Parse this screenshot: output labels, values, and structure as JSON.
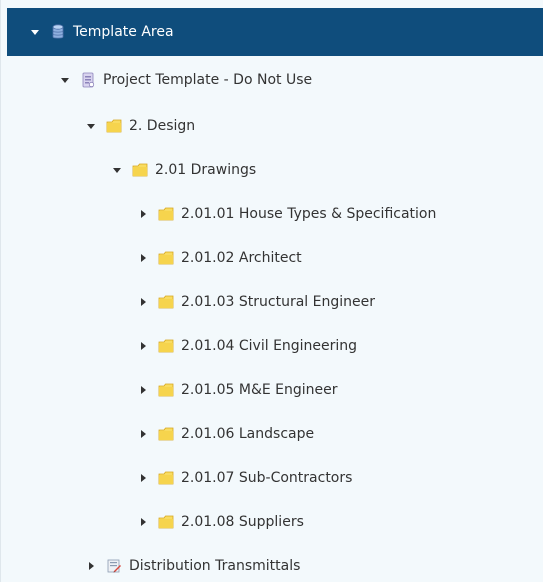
{
  "tree": {
    "root": {
      "label": "Template Area",
      "icon": "database-icon",
      "expanded": true
    },
    "project": {
      "label": "Project Template - Do Not Use",
      "icon": "project-icon",
      "expanded": true
    },
    "design": {
      "label": "2. Design",
      "icon": "folder-icon",
      "expanded": true
    },
    "drawings": {
      "label": "2.01 Drawings",
      "icon": "folder-icon",
      "expanded": true
    },
    "children": [
      {
        "label": "2.01.01 House Types & Specification",
        "icon": "folder-icon",
        "expanded": false
      },
      {
        "label": "2.01.02 Architect",
        "icon": "folder-icon",
        "expanded": false
      },
      {
        "label": "2.01.03 Structural Engineer",
        "icon": "folder-icon",
        "expanded": false
      },
      {
        "label": "2.01.04 Civil Engineering",
        "icon": "folder-icon",
        "expanded": false
      },
      {
        "label": "2.01.05 M&E Engineer",
        "icon": "folder-icon",
        "expanded": false
      },
      {
        "label": "2.01.06 Landscape",
        "icon": "folder-icon",
        "expanded": false
      },
      {
        "label": "2.01.07 Sub-Contractors",
        "icon": "folder-icon",
        "expanded": false
      },
      {
        "label": "2.01.08 Suppliers",
        "icon": "folder-icon",
        "expanded": false
      }
    ],
    "distribution": {
      "label": "Distribution Transmittals",
      "icon": "transmittal-icon",
      "expanded": false
    }
  },
  "colors": {
    "selected_background": "#0f4d7c",
    "tree_background": "#f3f9fc",
    "folder_fill": "#f6d44d",
    "folder_stroke": "#d8a51d"
  }
}
